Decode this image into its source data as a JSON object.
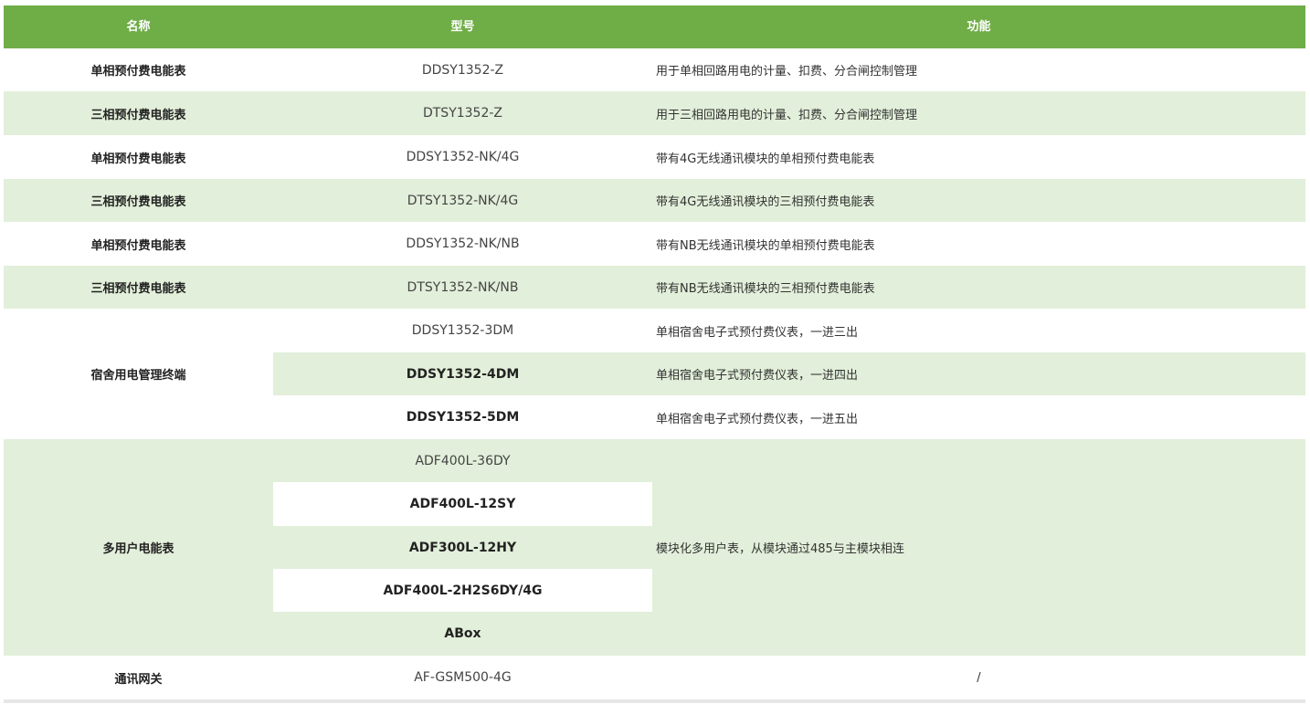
{
  "header": {
    "name": "名称",
    "model": "型号",
    "function": "功能"
  },
  "rows": [
    {
      "name": "单相预付费电能表",
      "model": "DDSY1352-Z",
      "function": "用于单相回路用电的计量、扣费、分合闸控制管理"
    },
    {
      "name": "三相预付费电能表",
      "model": "DTSY1352-Z",
      "function": "用于三相回路用电的计量、扣费、分合闸控制管理"
    },
    {
      "name": "单相预付费电能表",
      "model": "DDSY1352-NK/4G",
      "function": "带有4G无线通讯模块的单相预付费电能表"
    },
    {
      "name": "三相预付费电能表",
      "model": "DTSY1352-NK/4G",
      "function": "带有4G无线通讯模块的三相预付费电能表"
    },
    {
      "name": "单相预付费电能表",
      "model": "DDSY1352-NK/NB",
      "function": "带有NB无线通讯模块的单相预付费电能表"
    },
    {
      "name": "三相预付费电能表",
      "model": "DTSY1352-NK/NB",
      "function": "带有NB无线通讯模块的三相预付费电能表"
    }
  ],
  "dorm": {
    "name": "宿舍用电管理终端",
    "items": [
      {
        "model": "DDSY1352-3DM",
        "function": "单相宿舍电子式预付费仪表，一进三出"
      },
      {
        "model": "DDSY1352-4DM",
        "function": "单相宿舍电子式预付费仪表，一进四出"
      },
      {
        "model": "DDSY1352-5DM",
        "function": "单相宿舍电子式预付费仪表，一进五出"
      }
    ]
  },
  "multi": {
    "name": "多用户电能表",
    "models": [
      "ADF400L-36DY",
      "ADF400L-12SY",
      "ADF300L-12HY",
      "ADF400L-2H2S6DY/4G",
      "ABox"
    ],
    "function": "模块化多用户表，从模块通过485与主模块相连"
  },
  "gateway": {
    "name": "通讯网关",
    "model": "AF-GSM500-4G",
    "function": "/"
  },
  "colors": {
    "header_bg": "#6fad46",
    "stripe": "#e2efda",
    "white": "#ffffff"
  }
}
